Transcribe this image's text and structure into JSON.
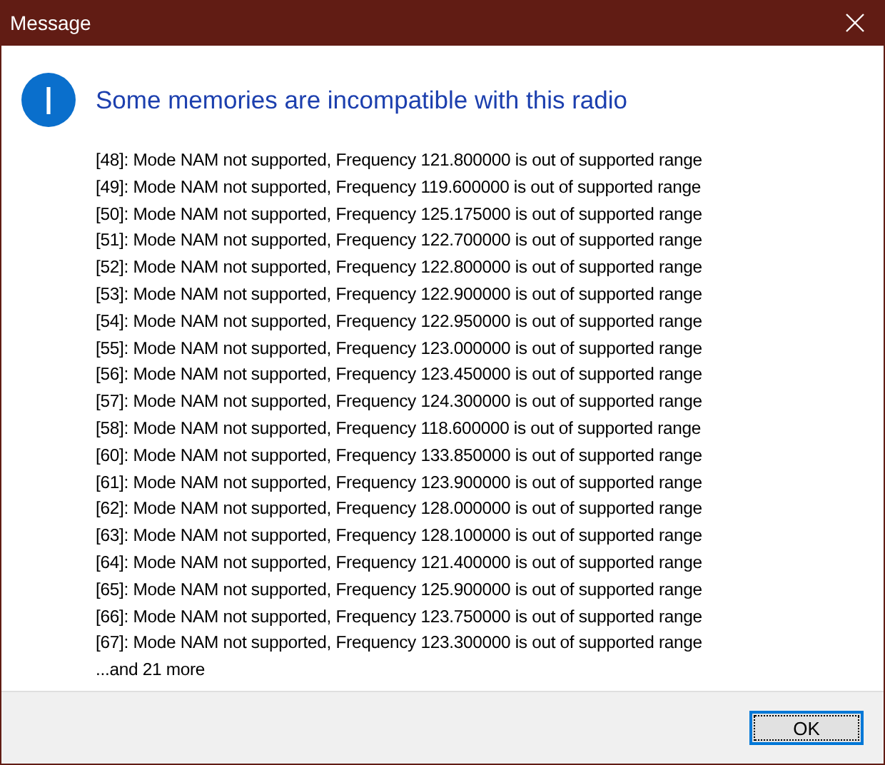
{
  "window": {
    "title": "Message"
  },
  "heading": "Some memories are incompatible with this radio",
  "messages": [
    "[48]: Mode NAM not supported, Frequency 121.800000 is out of supported range",
    "[49]: Mode NAM not supported, Frequency 119.600000 is out of supported range",
    "[50]: Mode NAM not supported, Frequency 125.175000 is out of supported range",
    "[51]: Mode NAM not supported, Frequency 122.700000 is out of supported range",
    "[52]: Mode NAM not supported, Frequency 122.800000 is out of supported range",
    "[53]: Mode NAM not supported, Frequency 122.900000 is out of supported range",
    "[54]: Mode NAM not supported, Frequency 122.950000 is out of supported range",
    "[55]: Mode NAM not supported, Frequency 123.000000 is out of supported range",
    "[56]: Mode NAM not supported, Frequency 123.450000 is out of supported range",
    "[57]: Mode NAM not supported, Frequency 124.300000 is out of supported range",
    "[58]: Mode NAM not supported, Frequency 118.600000 is out of supported range",
    "[60]: Mode NAM not supported, Frequency 133.850000 is out of supported range",
    "[61]: Mode NAM not supported, Frequency 123.900000 is out of supported range",
    "[62]: Mode NAM not supported, Frequency 128.000000 is out of supported range",
    "[63]: Mode NAM not supported, Frequency 128.100000 is out of supported range",
    "[64]: Mode NAM not supported, Frequency 121.400000 is out of supported range",
    "[65]: Mode NAM not supported, Frequency 125.900000 is out of supported range",
    "[66]: Mode NAM not supported, Frequency 123.750000 is out of supported range",
    "[67]: Mode NAM not supported, Frequency 123.300000 is out of supported range"
  ],
  "more": "...and 21 more",
  "buttons": [
    {
      "label": "OK",
      "selected": true
    }
  ]
}
